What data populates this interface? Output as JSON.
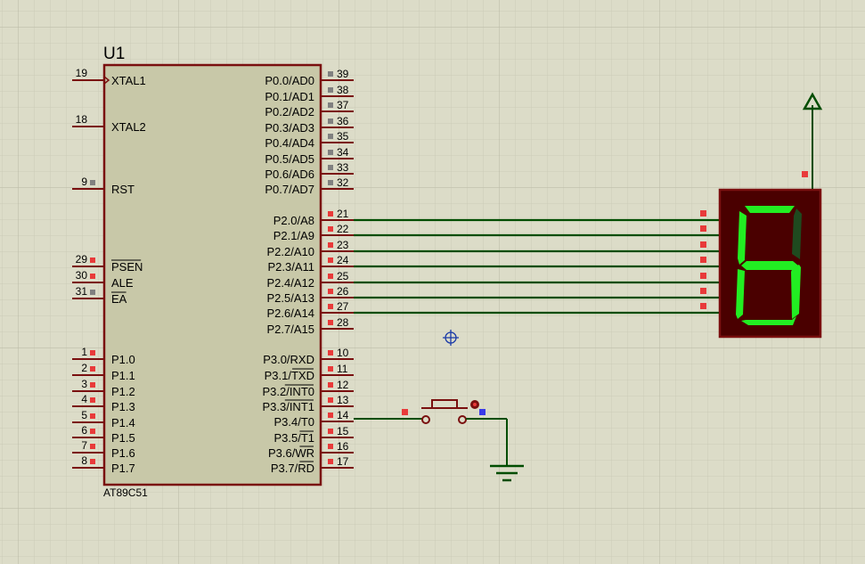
{
  "component": {
    "reference": "U1",
    "part_number": "AT89C51"
  },
  "left_pins": [
    {
      "num": "19",
      "name": "XTAL1",
      "state": "none",
      "clock": true
    },
    {
      "num": "18",
      "name": "XTAL2",
      "state": "none"
    },
    {
      "num": "9",
      "name": "RST",
      "state": "grey"
    },
    {
      "num": "29",
      "name": "PSEN",
      "state": "red",
      "overline": true
    },
    {
      "num": "30",
      "name": "ALE",
      "state": "red"
    },
    {
      "num": "31",
      "name": "EA",
      "state": "grey",
      "overline": true
    },
    {
      "num": "1",
      "name": "P1.0",
      "state": "red"
    },
    {
      "num": "2",
      "name": "P1.1",
      "state": "red"
    },
    {
      "num": "3",
      "name": "P1.2",
      "state": "red"
    },
    {
      "num": "4",
      "name": "P1.3",
      "state": "red"
    },
    {
      "num": "5",
      "name": "P1.4",
      "state": "red"
    },
    {
      "num": "6",
      "name": "P1.5",
      "state": "red"
    },
    {
      "num": "7",
      "name": "P1.6",
      "state": "red"
    },
    {
      "num": "8",
      "name": "P1.7",
      "state": "red"
    }
  ],
  "right_pins": [
    {
      "num": "39",
      "name": "P0.0/AD0",
      "state": "grey"
    },
    {
      "num": "38",
      "name": "P0.1/AD1",
      "state": "grey"
    },
    {
      "num": "37",
      "name": "P0.2/AD2",
      "state": "grey"
    },
    {
      "num": "36",
      "name": "P0.3/AD3",
      "state": "grey"
    },
    {
      "num": "35",
      "name": "P0.4/AD4",
      "state": "grey"
    },
    {
      "num": "34",
      "name": "P0.5/AD5",
      "state": "grey"
    },
    {
      "num": "33",
      "name": "P0.6/AD6",
      "state": "grey"
    },
    {
      "num": "32",
      "name": "P0.7/AD7",
      "state": "grey"
    },
    {
      "num": "21",
      "name": "P2.0/A8",
      "state": "red"
    },
    {
      "num": "22",
      "name": "P2.1/A9",
      "state": "red"
    },
    {
      "num": "23",
      "name": "P2.2/A10",
      "state": "red"
    },
    {
      "num": "24",
      "name": "P2.3/A11",
      "state": "red"
    },
    {
      "num": "25",
      "name": "P2.4/A12",
      "state": "red"
    },
    {
      "num": "26",
      "name": "P2.5/A13",
      "state": "red"
    },
    {
      "num": "27",
      "name": "P2.6/A14",
      "state": "red"
    },
    {
      "num": "28",
      "name": "P2.7/A15",
      "state": "red"
    },
    {
      "num": "10",
      "name": "P3.0/RXD",
      "state": "red"
    },
    {
      "num": "11",
      "name": "P3.1/TXD",
      "state": "red",
      "ol_from": 5
    },
    {
      "num": "12",
      "name": "P3.2/INT0",
      "state": "red",
      "ol_from": 5
    },
    {
      "num": "13",
      "name": "P3.3/INT1",
      "state": "red",
      "ol_from": 5
    },
    {
      "num": "14",
      "name": "P3.4/T0",
      "state": "red"
    },
    {
      "num": "15",
      "name": "P3.5/T1",
      "state": "red",
      "ol_from": 5
    },
    {
      "num": "16",
      "name": "P3.6/WR",
      "state": "red",
      "ol_from": 5
    },
    {
      "num": "17",
      "name": "P3.7/RD",
      "state": "red",
      "ol_from": 5
    }
  ],
  "seven_segment": {
    "segments_lit": {
      "a": true,
      "b": false,
      "c": true,
      "d": true,
      "e": true,
      "f": true,
      "g": true
    },
    "colors": {
      "lit": "#22ee22",
      "off": "#1f4a1f",
      "body": "#4a0000"
    }
  },
  "colors": {
    "background": "#dcdcc8",
    "chip_body": "#c8c8a8",
    "chip_outline": "#7a0f0f",
    "wire": "#004d00",
    "pin_high": "#e83a3a",
    "pin_unused": "#808080",
    "power": "#004d00"
  }
}
